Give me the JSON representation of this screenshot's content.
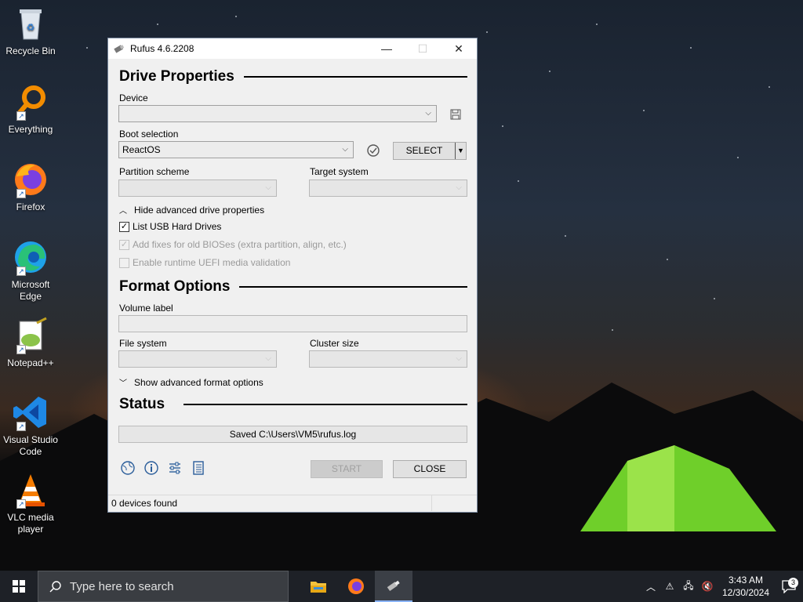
{
  "desktop": {
    "icons": [
      {
        "label": "Recycle Bin"
      },
      {
        "label": "Everything"
      },
      {
        "label": "Firefox"
      },
      {
        "label": "Microsoft Edge"
      },
      {
        "label": "Notepad++"
      },
      {
        "label": "Visual Studio Code"
      },
      {
        "label": "VLC media player"
      }
    ]
  },
  "window": {
    "title": "Rufus 4.6.2208",
    "minimize": "—",
    "maximize": "☐",
    "close": "✕"
  },
  "drive": {
    "header": "Drive Properties",
    "device_label": "Device",
    "device_value": "",
    "boot_label": "Boot selection",
    "boot_value": "ReactOS",
    "select_button": "SELECT",
    "partition_label": "Partition scheme",
    "target_label": "Target system",
    "advanced_toggle": "Hide advanced drive properties",
    "list_usb": "List USB Hard Drives",
    "list_usb_checked": true,
    "old_bios": "Add fixes for old BIOSes (extra partition, align, etc.)",
    "uefi_validation": "Enable runtime UEFI media validation"
  },
  "format": {
    "header": "Format Options",
    "volume_label": "Volume label",
    "volume_value": "",
    "fs_label": "File system",
    "cluster_label": "Cluster size",
    "advanced_toggle": "Show advanced format options"
  },
  "status": {
    "header": "Status",
    "message": "Saved C:\\Users\\VM5\\rufus.log",
    "start_button": "START",
    "close_button": "CLOSE",
    "footer": "0 devices found"
  },
  "taskbar": {
    "search_placeholder": "Type here to search",
    "time": "3:43 AM",
    "date": "12/30/2024",
    "notification_count": "3"
  },
  "colors": {
    "accent": "#0078d7",
    "taskbar": "#1e2127"
  }
}
